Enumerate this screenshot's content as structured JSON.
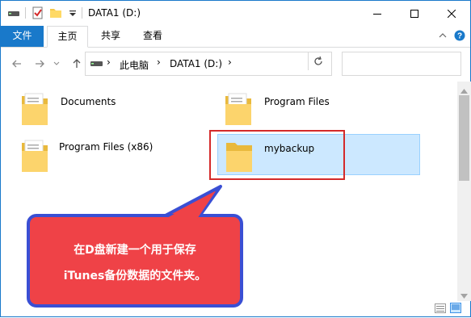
{
  "window": {
    "title": "DATA1 (D:)"
  },
  "ribbon": {
    "tabs": [
      {
        "label": "文件"
      },
      {
        "label": "主页"
      },
      {
        "label": "共享"
      },
      {
        "label": "查看"
      }
    ]
  },
  "address": {
    "segments": [
      "此电脑",
      "DATA1 (D:)"
    ]
  },
  "search": {
    "placeholder": ""
  },
  "files": [
    {
      "name": "Documents"
    },
    {
      "name": "Program Files"
    },
    {
      "name": "Program Files (x86)"
    },
    {
      "name": "mybackup",
      "selected": true
    }
  ],
  "callout": {
    "line1": "在D盘新建一个用于保存",
    "line2": "iTunes备份数据的文件夹。"
  },
  "colors": {
    "accent": "#1979ca",
    "selection": "#cce8ff",
    "highlight_border": "#d42a2a",
    "callout_fill": "#ef4247",
    "callout_border": "#3a4fd4"
  }
}
